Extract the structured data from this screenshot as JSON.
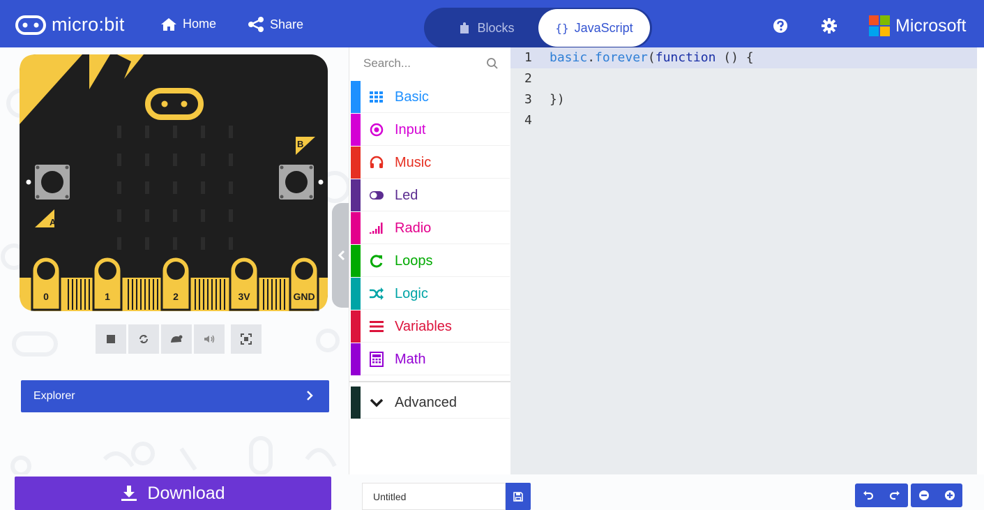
{
  "header": {
    "brand": "micro:bit",
    "home_label": "Home",
    "share_label": "Share",
    "mode_blocks_label": "Blocks",
    "mode_js_icon": "{}",
    "mode_js_label": "JavaScript",
    "help_icon": "question-circle-icon",
    "settings_icon": "gear-icon",
    "microsoft_label": "Microsoft"
  },
  "simulator": {
    "button_a": "A",
    "button_b": "B",
    "pins": [
      "0",
      "1",
      "2",
      "3V",
      "GND"
    ],
    "controls": [
      "stop-icon",
      "restart-icon",
      "slow-mo-icon",
      "mute-icon",
      "fullscreen-icon"
    ],
    "explorer_label": "Explorer"
  },
  "toolbox": {
    "search_placeholder": "Search...",
    "categories": [
      {
        "label": "Basic",
        "color": "#1e90ff",
        "icon": "grid-icon"
      },
      {
        "label": "Input",
        "color": "#d400d4",
        "icon": "target-icon"
      },
      {
        "label": "Music",
        "color": "#e63022",
        "icon": "headphones-icon"
      },
      {
        "label": "Led",
        "color": "#5c2d91",
        "icon": "toggle-icon"
      },
      {
        "label": "Radio",
        "color": "#e3008c",
        "icon": "signal-bars-icon"
      },
      {
        "label": "Loops",
        "color": "#00aa00",
        "icon": "refresh-icon"
      },
      {
        "label": "Logic",
        "color": "#00a4a6",
        "icon": "shuffle-icon"
      },
      {
        "label": "Variables",
        "color": "#dc143c",
        "icon": "list-icon"
      },
      {
        "label": "Math",
        "color": "#9400d3",
        "icon": "calculator-icon"
      }
    ],
    "advanced": {
      "label": "Advanced",
      "color": "#3c3c3c",
      "icon": "chevron-down-icon"
    }
  },
  "editor": {
    "line_numbers": [
      "1",
      "2",
      "3",
      "4"
    ],
    "line1": {
      "obj": "basic",
      "dot": ".",
      "fn": "forever",
      "open": "(",
      "kw": "function",
      "rest": " () {"
    },
    "line3": "})"
  },
  "footer": {
    "download_label": "Download",
    "project_name": "Untitled",
    "save_icon": "floppy-disk-icon",
    "undo_icon": "undo-icon",
    "redo_icon": "redo-icon",
    "zoom_out_icon": "zoom-out-icon",
    "zoom_in_icon": "zoom-in-icon"
  },
  "colors": {
    "header": "#3454d1",
    "download": "#6b35d4",
    "editor_bg": "#e9ecef",
    "board": "#1e1e1e",
    "board_accent": "#f5c842"
  }
}
